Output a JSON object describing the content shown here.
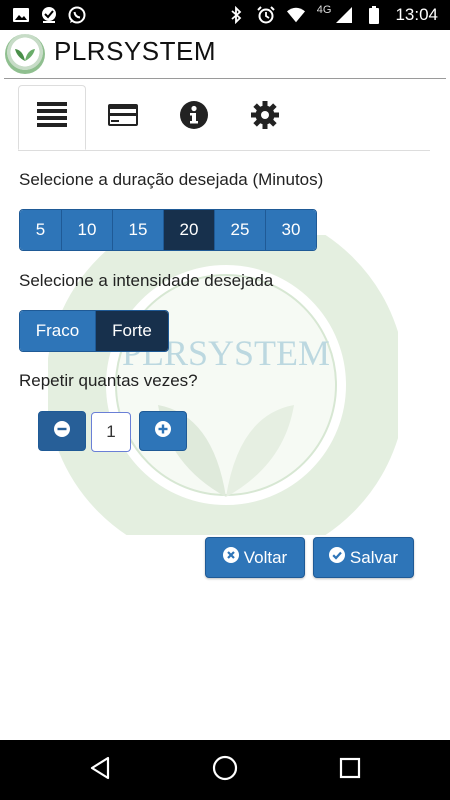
{
  "app": {
    "title": "PLRSYSTEM",
    "watermark_text": "PLRSYSTEM"
  },
  "status_bar": {
    "time": "13:04",
    "network": "4G"
  },
  "tabs": [
    {
      "icon": "list-icon",
      "active": true
    },
    {
      "icon": "credit-card-icon",
      "active": false
    },
    {
      "icon": "info-icon",
      "active": false
    },
    {
      "icon": "gear-icon",
      "active": false
    }
  ],
  "duration": {
    "label": "Selecione a duração desejada (Minutos)",
    "options": [
      "5",
      "10",
      "15",
      "20",
      "25",
      "30"
    ],
    "selected": "20"
  },
  "intensity": {
    "label": "Selecione a intensidade desejada",
    "options": [
      "Fraco",
      "Forte"
    ],
    "selected": "Forte"
  },
  "repeat": {
    "label": "Repetir quantas vezes?",
    "value": "1"
  },
  "actions": {
    "back_label": "Voltar",
    "save_label": "Salvar"
  },
  "colors": {
    "button": "#2e75b8",
    "button_active": "#17304c",
    "accent_green": "#8fbf8f"
  }
}
